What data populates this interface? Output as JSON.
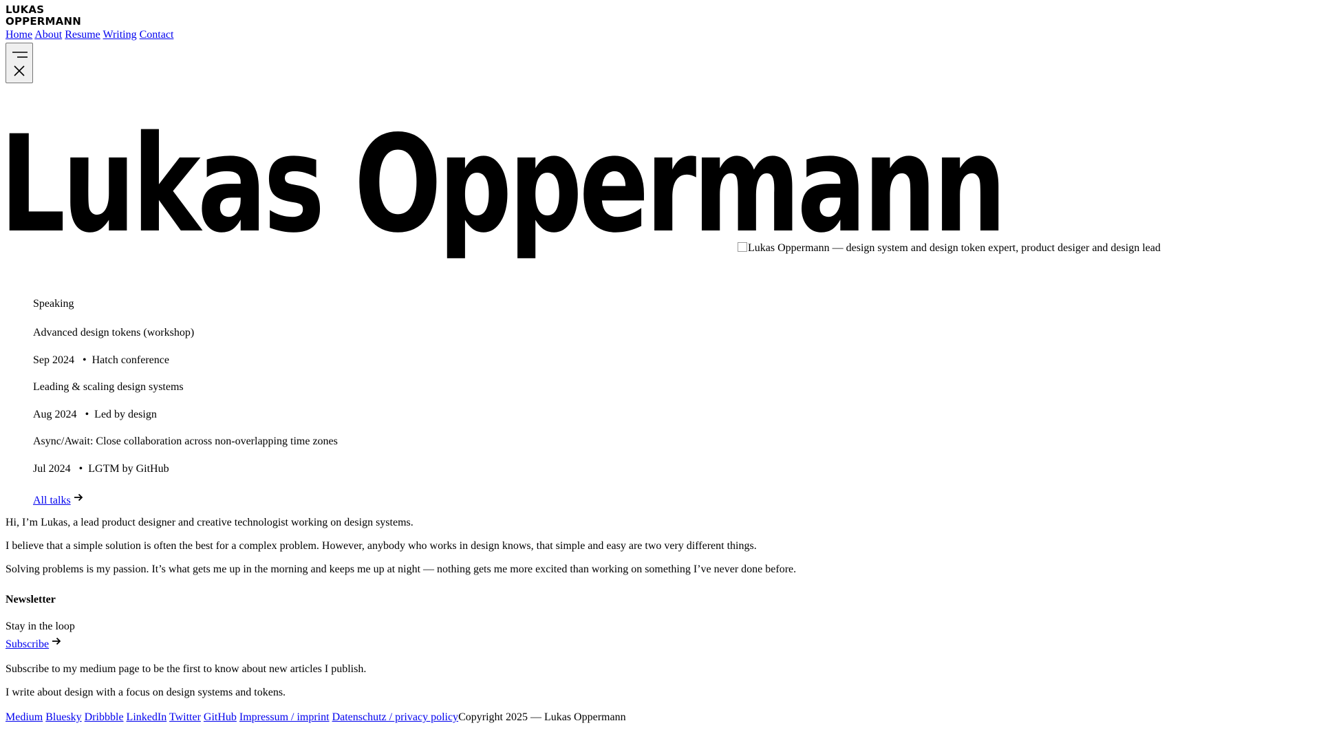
{
  "logo": {
    "line1": "LUKAS",
    "line2": "OPPERMANN"
  },
  "nav": {
    "home": "Home",
    "about": "About",
    "resume": "Resume",
    "writing": "Writing",
    "contact": "Contact"
  },
  "hero": {
    "name": "Lukas Oppermann",
    "image_alt": "Lukas Oppermann — design system and design token expert, product desiger and design lead"
  },
  "speaking": {
    "heading": "Speaking",
    "talks": [
      {
        "title": "Advanced design tokens (workshop)",
        "date": "Sep 2024",
        "event": "Hatch conference"
      },
      {
        "title": "Leading & scaling design systems",
        "date": "Aug 2024",
        "event": "Led by design"
      },
      {
        "title": "Async/Await: Close collaboration across non-overlapping time zones",
        "date": "Jul 2024",
        "event": "LGTM by GitHub"
      }
    ],
    "separator": "•",
    "all_talks_label": "All talks"
  },
  "about": {
    "p1": "Hi, I’m Lukas, a lead product designer and creative technologist working on design systems.",
    "p2": "I believe that a simple solution is often the best for a complex problem. However, anybody who works in design knows, that simple and easy are two very different things.",
    "p3": "Solving problems is my passion. It’s what gets me up in the morning and keeps me up at night — nothing gets me more excited than working on something I’ve never done before."
  },
  "newsletter": {
    "heading": "Newsletter",
    "tagline": "Stay in the loop",
    "subscribe_label": "Subscribe",
    "text1": "Subscribe to my medium page to be the first to know about new articles I publish.",
    "text2": "I write about design with a focus on design systems and tokens."
  },
  "footer": {
    "medium": "Medium",
    "bluesky": "Bluesky",
    "dribbble": "Dribbble",
    "linkedin": "LinkedIn",
    "twitter": "Twitter",
    "github": "GitHub",
    "impressum": "Impressum / imprint",
    "privacy": "Datenschutz / privacy policy",
    "copyright": "Copyright 2025 — Lukas Oppermann"
  },
  "icons": {
    "menu": "menu-icon",
    "close": "close-icon",
    "arrow": "arrow-right-icon"
  },
  "colors": {
    "link": "#0000ee",
    "text": "#000000",
    "background": "#ffffff"
  }
}
